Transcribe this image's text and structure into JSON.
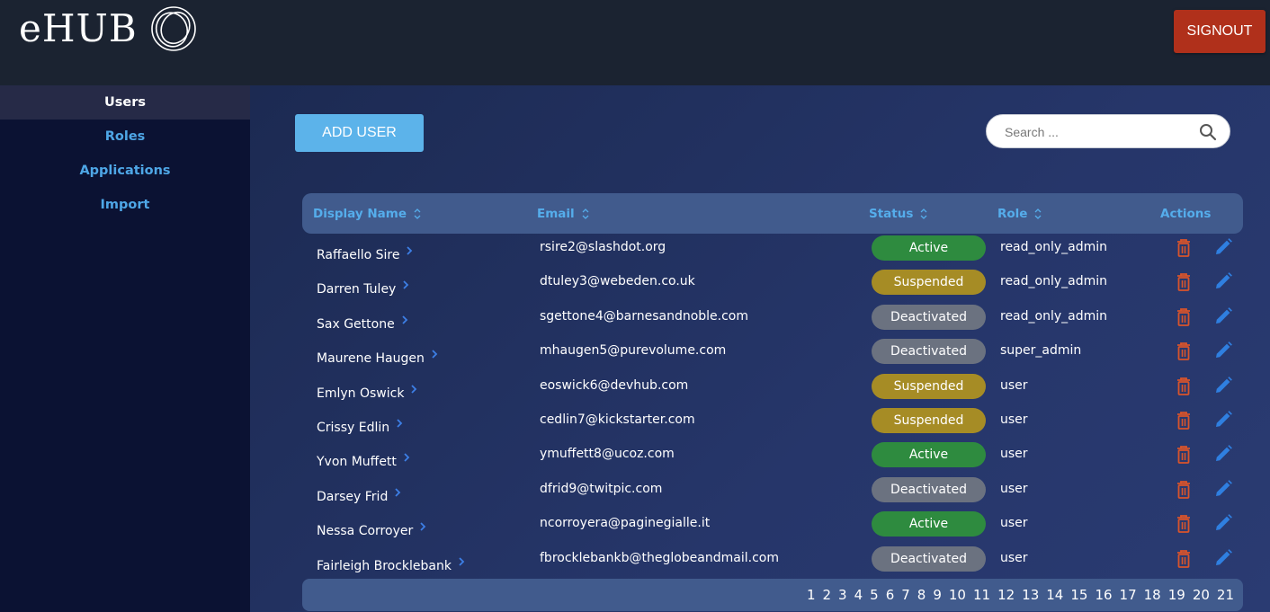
{
  "header": {
    "logo_text": "eHUB",
    "signout_label": "SIGNOUT"
  },
  "sidebar": {
    "items": [
      {
        "label": "Users",
        "active": true
      },
      {
        "label": "Roles",
        "active": false
      },
      {
        "label": "Applications",
        "active": false
      },
      {
        "label": "Import",
        "active": false
      }
    ]
  },
  "toolbar": {
    "add_user_label": "ADD USER",
    "search_placeholder": "Search ...",
    "search_value": ""
  },
  "table": {
    "columns": {
      "display_name": "Display Name",
      "email": "Email",
      "status": "Status",
      "role": "Role",
      "actions": "Actions"
    },
    "rows": [
      {
        "name": "Raffaello Sire",
        "email": "rsire2@slashdot.org",
        "status": "Active",
        "role": "read_only_admin"
      },
      {
        "name": "Darren Tuley",
        "email": "dtuley3@webeden.co.uk",
        "status": "Suspended",
        "role": "read_only_admin"
      },
      {
        "name": "Sax Gettone",
        "email": "sgettone4@barnesandnoble.com",
        "status": "Deactivated",
        "role": "read_only_admin"
      },
      {
        "name": "Maurene Haugen",
        "email": "mhaugen5@purevolume.com",
        "status": "Deactivated",
        "role": "super_admin"
      },
      {
        "name": "Emlyn Oswick",
        "email": "eoswick6@devhub.com",
        "status": "Suspended",
        "role": "user"
      },
      {
        "name": "Crissy Edlin",
        "email": "cedlin7@kickstarter.com",
        "status": "Suspended",
        "role": "user"
      },
      {
        "name": "Yvon Muffett",
        "email": "ymuffett8@ucoz.com",
        "status": "Active",
        "role": "user"
      },
      {
        "name": "Darsey Frid",
        "email": "dfrid9@twitpic.com",
        "status": "Deactivated",
        "role": "user"
      },
      {
        "name": "Nessa Corroyer",
        "email": "ncorroyera@paginegialle.it",
        "status": "Active",
        "role": "user"
      },
      {
        "name": "Fairleigh Brocklebank",
        "email": "fbrocklebankb@theglobeandmail.com",
        "status": "Deactivated",
        "role": "user"
      }
    ]
  },
  "status_colors": {
    "Active": "#2e8b3f",
    "Suspended": "#a68c25",
    "Deactivated": "#6b7280"
  },
  "colors": {
    "accent": "#5cb3ea",
    "signout": "#b0301b",
    "delete_icon": "#d9542b",
    "edit_icon": "#2f7fe0"
  },
  "icons": {
    "delete": "trash-icon",
    "edit": "pencil-icon",
    "row_expand": "chevron-right-icon",
    "search": "search-icon",
    "sort": "sort-icon"
  },
  "pagination": {
    "pages": [
      "1",
      "2",
      "3",
      "4",
      "5",
      "6",
      "7",
      "8",
      "9",
      "10",
      "11",
      "12",
      "13",
      "14",
      "15",
      "16",
      "17",
      "18",
      "19",
      "20",
      "21"
    ]
  }
}
